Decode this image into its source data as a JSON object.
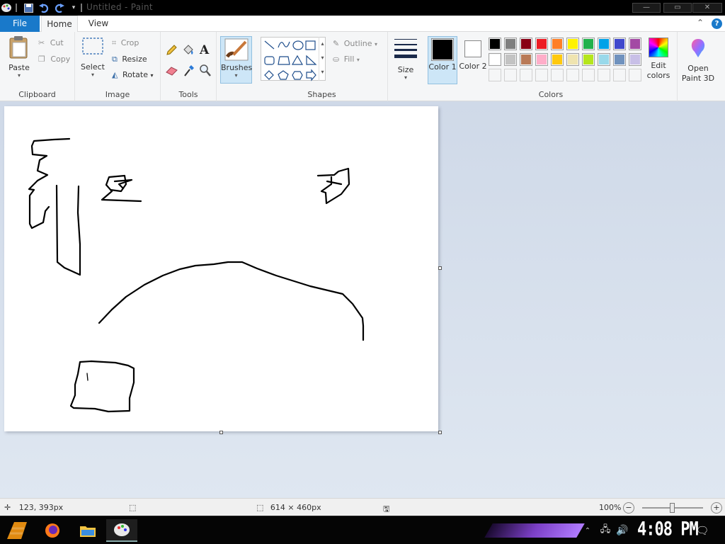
{
  "window": {
    "title": "Untitled - Paint"
  },
  "tabs": {
    "file": "File",
    "home": "Home",
    "view": "View"
  },
  "ribbon": {
    "clipboard": {
      "paste": "Paste",
      "cut": "Cut",
      "copy": "Copy",
      "label": "Clipboard"
    },
    "image": {
      "select": "Select",
      "crop": "Crop",
      "resize": "Resize",
      "rotate": "Rotate",
      "label": "Image"
    },
    "tools": {
      "label": "Tools"
    },
    "brushes": {
      "label": "Brushes"
    },
    "shapes": {
      "outline": "Outline",
      "fill": "Fill",
      "label": "Shapes"
    },
    "size": {
      "label": "Size"
    },
    "colors": {
      "color1": "Color 1",
      "color2": "Color 2",
      "edit": "Edit colors",
      "label": "Colors",
      "color1_value": "#000000",
      "color2_value": "#ffffff",
      "palette_row1": [
        "#000000",
        "#7f7f7f",
        "#880015",
        "#ed1c24",
        "#ff7f27",
        "#fff200",
        "#22b14c",
        "#00a2e8",
        "#3f48cc",
        "#a349a4"
      ],
      "palette_row2": [
        "#ffffff",
        "#c3c3c3",
        "#b97a57",
        "#ffaec9",
        "#ffc90e",
        "#efe4b0",
        "#b5e61d",
        "#99d9ea",
        "#7092be",
        "#c8bfe7"
      ]
    },
    "paint3d": {
      "label": "Open Paint 3D"
    }
  },
  "status": {
    "cursor_pos": "123, 393px",
    "canvas_size": "614 × 460px",
    "zoom": "100%",
    "zoom_level": 0.5
  },
  "taskbar": {
    "clock": "4:08 PM"
  }
}
